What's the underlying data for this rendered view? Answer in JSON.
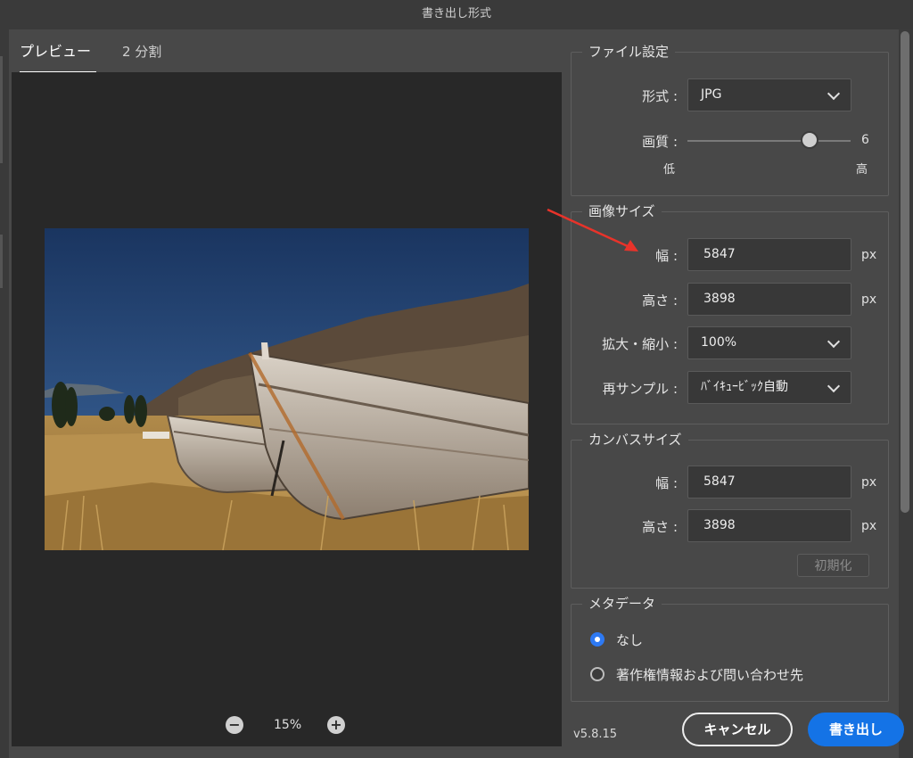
{
  "window": {
    "title": "書き出し形式"
  },
  "tabs": [
    {
      "label": "プレビュー",
      "active": true
    },
    {
      "label": "2 分割",
      "active": false
    }
  ],
  "zoom": {
    "minus": "−",
    "value": "15%",
    "plus": "+"
  },
  "file_settings": {
    "legend": "ファイル設定",
    "format_label": "形式 :",
    "format_value": "JPG",
    "quality_label": "画質 :",
    "quality_value": "6",
    "quality_fraction": 0.75,
    "quality_low": "低",
    "quality_high": "高"
  },
  "image_size": {
    "legend": "画像サイズ",
    "width_label": "幅 :",
    "width_value": "5847",
    "height_label": "高さ :",
    "height_value": "3898",
    "unit": "px",
    "scale_label": "拡大・縮小 :",
    "scale_value": "100%",
    "resample_label": "再サンプル :",
    "resample_value": "ﾊﾞｲｷｭｰﾋﾞｯｸ自動"
  },
  "canvas_size": {
    "legend": "カンバスサイズ",
    "width_label": "幅 :",
    "width_value": "5847",
    "height_label": "高さ :",
    "height_value": "3898",
    "unit": "px",
    "reset_label": "初期化"
  },
  "metadata": {
    "legend": "メタデータ",
    "options": [
      {
        "label": "なし",
        "selected": true
      },
      {
        "label": "著作権情報および問い合わせ先",
        "selected": false
      }
    ]
  },
  "footer": {
    "version": "v5.8.15",
    "cancel_label": "キャンセル",
    "export_label": "書き出し"
  },
  "colors": {
    "accent": "#1473e6",
    "annotation_arrow": "#e8332a",
    "sky": "#1f3b63"
  }
}
